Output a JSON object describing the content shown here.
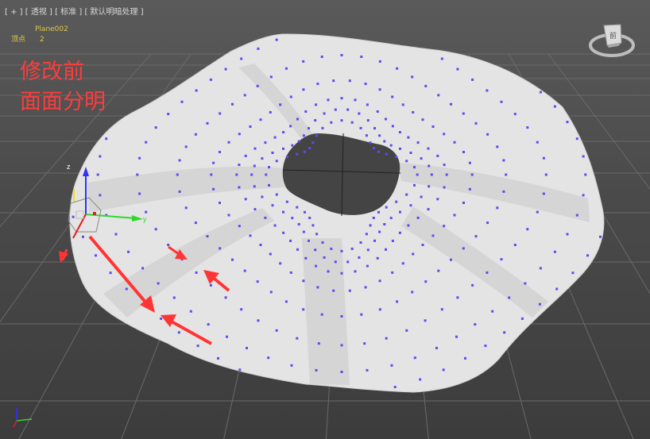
{
  "viewport": {
    "menu": {
      "plus": "[ + ]",
      "view": "[ 透视 ]",
      "shading": "[ 标准 ]",
      "lighting": "[ 默认明暗处理 ]"
    },
    "stats": {
      "object_name": "Plane002",
      "vertex_label": "顶点",
      "vertex_count": "2"
    },
    "note": {
      "line1": "修改前",
      "line2": "面面分明"
    },
    "gizmo": {
      "x": "x",
      "y": "y",
      "z": "z"
    },
    "viewcube": {
      "face": "前"
    },
    "colors": {
      "background": "#4a4a4a",
      "grid": "#6a6a6a",
      "mesh": "#e6e6e6",
      "vertex": "#5a4cf0",
      "note": "#ff3c3c",
      "stats": "#e0c84a",
      "arrow": "#ff3434"
    }
  }
}
